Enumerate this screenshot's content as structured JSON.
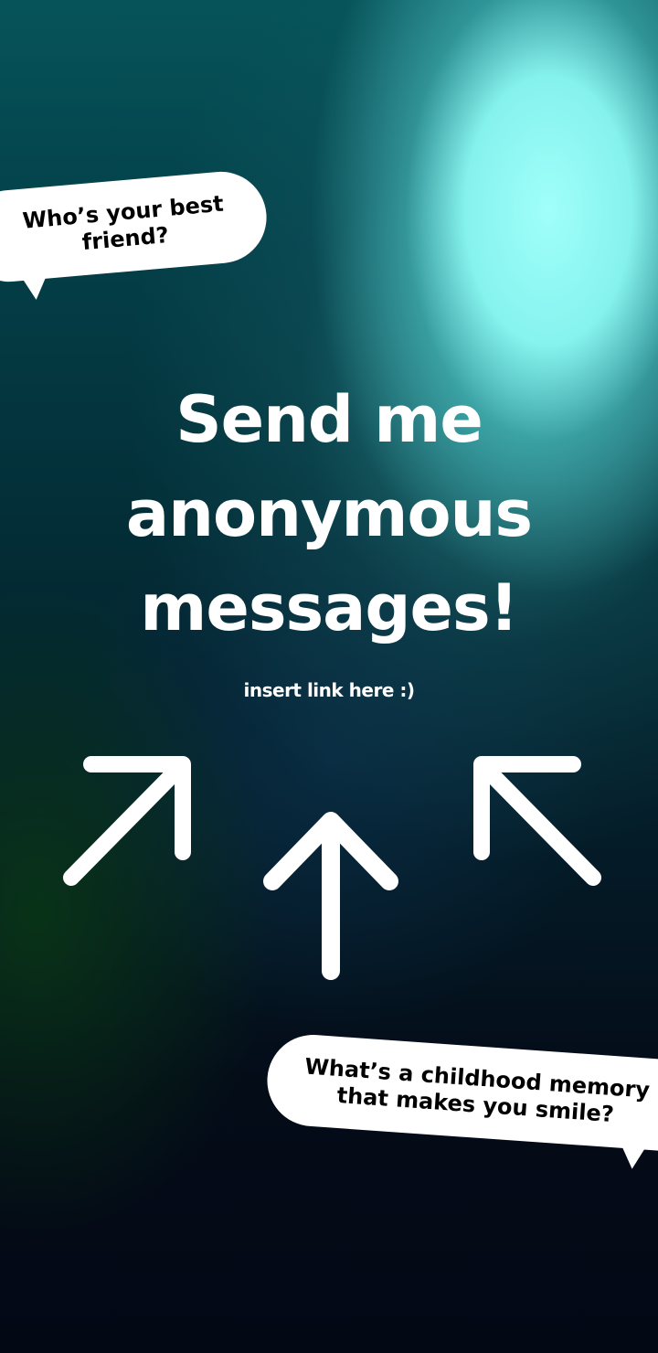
{
  "bubbles": {
    "top": {
      "line1": "Who’s your best",
      "line2": "friend?"
    },
    "bottom": {
      "line1": "What’s a childhood memory",
      "line2": "that makes you smile?"
    }
  },
  "headline": {
    "line1": "Send me",
    "line2": "anonymous",
    "line3": "messages!"
  },
  "subline": "insert link here :)",
  "icons": [
    "arrow-up-right-icon",
    "arrow-up-icon",
    "arrow-up-left-icon"
  ],
  "colors": {
    "text": "#ffffff",
    "bubble": "#ffffff",
    "glow": "#a0fffa",
    "background_dark": "#030815"
  }
}
